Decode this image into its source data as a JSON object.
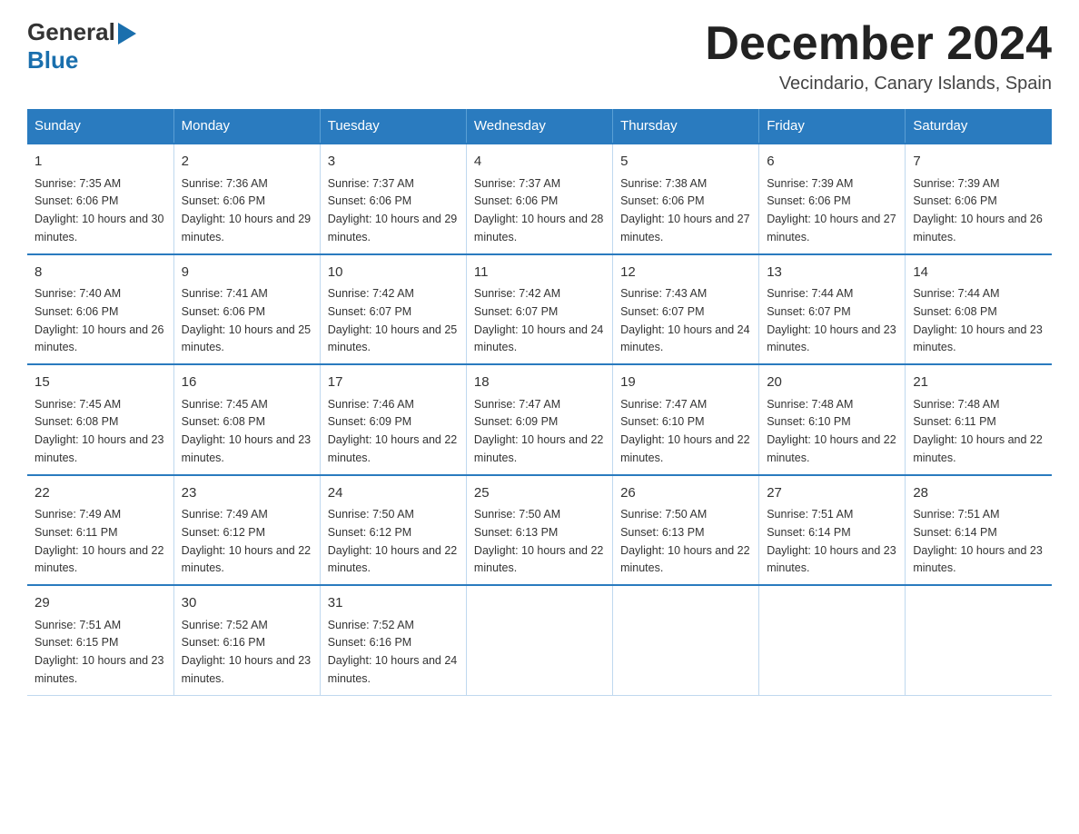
{
  "header": {
    "logo_general": "General",
    "logo_blue": "Blue",
    "title": "December 2024",
    "subtitle": "Vecindario, Canary Islands, Spain"
  },
  "calendar": {
    "days_of_week": [
      "Sunday",
      "Monday",
      "Tuesday",
      "Wednesday",
      "Thursday",
      "Friday",
      "Saturday"
    ],
    "weeks": [
      [
        {
          "day": "1",
          "sunrise": "7:35 AM",
          "sunset": "6:06 PM",
          "daylight": "10 hours and 30 minutes."
        },
        {
          "day": "2",
          "sunrise": "7:36 AM",
          "sunset": "6:06 PM",
          "daylight": "10 hours and 29 minutes."
        },
        {
          "day": "3",
          "sunrise": "7:37 AM",
          "sunset": "6:06 PM",
          "daylight": "10 hours and 29 minutes."
        },
        {
          "day": "4",
          "sunrise": "7:37 AM",
          "sunset": "6:06 PM",
          "daylight": "10 hours and 28 minutes."
        },
        {
          "day": "5",
          "sunrise": "7:38 AM",
          "sunset": "6:06 PM",
          "daylight": "10 hours and 27 minutes."
        },
        {
          "day": "6",
          "sunrise": "7:39 AM",
          "sunset": "6:06 PM",
          "daylight": "10 hours and 27 minutes."
        },
        {
          "day": "7",
          "sunrise": "7:39 AM",
          "sunset": "6:06 PM",
          "daylight": "10 hours and 26 minutes."
        }
      ],
      [
        {
          "day": "8",
          "sunrise": "7:40 AM",
          "sunset": "6:06 PM",
          "daylight": "10 hours and 26 minutes."
        },
        {
          "day": "9",
          "sunrise": "7:41 AM",
          "sunset": "6:06 PM",
          "daylight": "10 hours and 25 minutes."
        },
        {
          "day": "10",
          "sunrise": "7:42 AM",
          "sunset": "6:07 PM",
          "daylight": "10 hours and 25 minutes."
        },
        {
          "day": "11",
          "sunrise": "7:42 AM",
          "sunset": "6:07 PM",
          "daylight": "10 hours and 24 minutes."
        },
        {
          "day": "12",
          "sunrise": "7:43 AM",
          "sunset": "6:07 PM",
          "daylight": "10 hours and 24 minutes."
        },
        {
          "day": "13",
          "sunrise": "7:44 AM",
          "sunset": "6:07 PM",
          "daylight": "10 hours and 23 minutes."
        },
        {
          "day": "14",
          "sunrise": "7:44 AM",
          "sunset": "6:08 PM",
          "daylight": "10 hours and 23 minutes."
        }
      ],
      [
        {
          "day": "15",
          "sunrise": "7:45 AM",
          "sunset": "6:08 PM",
          "daylight": "10 hours and 23 minutes."
        },
        {
          "day": "16",
          "sunrise": "7:45 AM",
          "sunset": "6:08 PM",
          "daylight": "10 hours and 23 minutes."
        },
        {
          "day": "17",
          "sunrise": "7:46 AM",
          "sunset": "6:09 PM",
          "daylight": "10 hours and 22 minutes."
        },
        {
          "day": "18",
          "sunrise": "7:47 AM",
          "sunset": "6:09 PM",
          "daylight": "10 hours and 22 minutes."
        },
        {
          "day": "19",
          "sunrise": "7:47 AM",
          "sunset": "6:10 PM",
          "daylight": "10 hours and 22 minutes."
        },
        {
          "day": "20",
          "sunrise": "7:48 AM",
          "sunset": "6:10 PM",
          "daylight": "10 hours and 22 minutes."
        },
        {
          "day": "21",
          "sunrise": "7:48 AM",
          "sunset": "6:11 PM",
          "daylight": "10 hours and 22 minutes."
        }
      ],
      [
        {
          "day": "22",
          "sunrise": "7:49 AM",
          "sunset": "6:11 PM",
          "daylight": "10 hours and 22 minutes."
        },
        {
          "day": "23",
          "sunrise": "7:49 AM",
          "sunset": "6:12 PM",
          "daylight": "10 hours and 22 minutes."
        },
        {
          "day": "24",
          "sunrise": "7:50 AM",
          "sunset": "6:12 PM",
          "daylight": "10 hours and 22 minutes."
        },
        {
          "day": "25",
          "sunrise": "7:50 AM",
          "sunset": "6:13 PM",
          "daylight": "10 hours and 22 minutes."
        },
        {
          "day": "26",
          "sunrise": "7:50 AM",
          "sunset": "6:13 PM",
          "daylight": "10 hours and 22 minutes."
        },
        {
          "day": "27",
          "sunrise": "7:51 AM",
          "sunset": "6:14 PM",
          "daylight": "10 hours and 23 minutes."
        },
        {
          "day": "28",
          "sunrise": "7:51 AM",
          "sunset": "6:14 PM",
          "daylight": "10 hours and 23 minutes."
        }
      ],
      [
        {
          "day": "29",
          "sunrise": "7:51 AM",
          "sunset": "6:15 PM",
          "daylight": "10 hours and 23 minutes."
        },
        {
          "day": "30",
          "sunrise": "7:52 AM",
          "sunset": "6:16 PM",
          "daylight": "10 hours and 23 minutes."
        },
        {
          "day": "31",
          "sunrise": "7:52 AM",
          "sunset": "6:16 PM",
          "daylight": "10 hours and 24 minutes."
        },
        null,
        null,
        null,
        null
      ]
    ]
  }
}
